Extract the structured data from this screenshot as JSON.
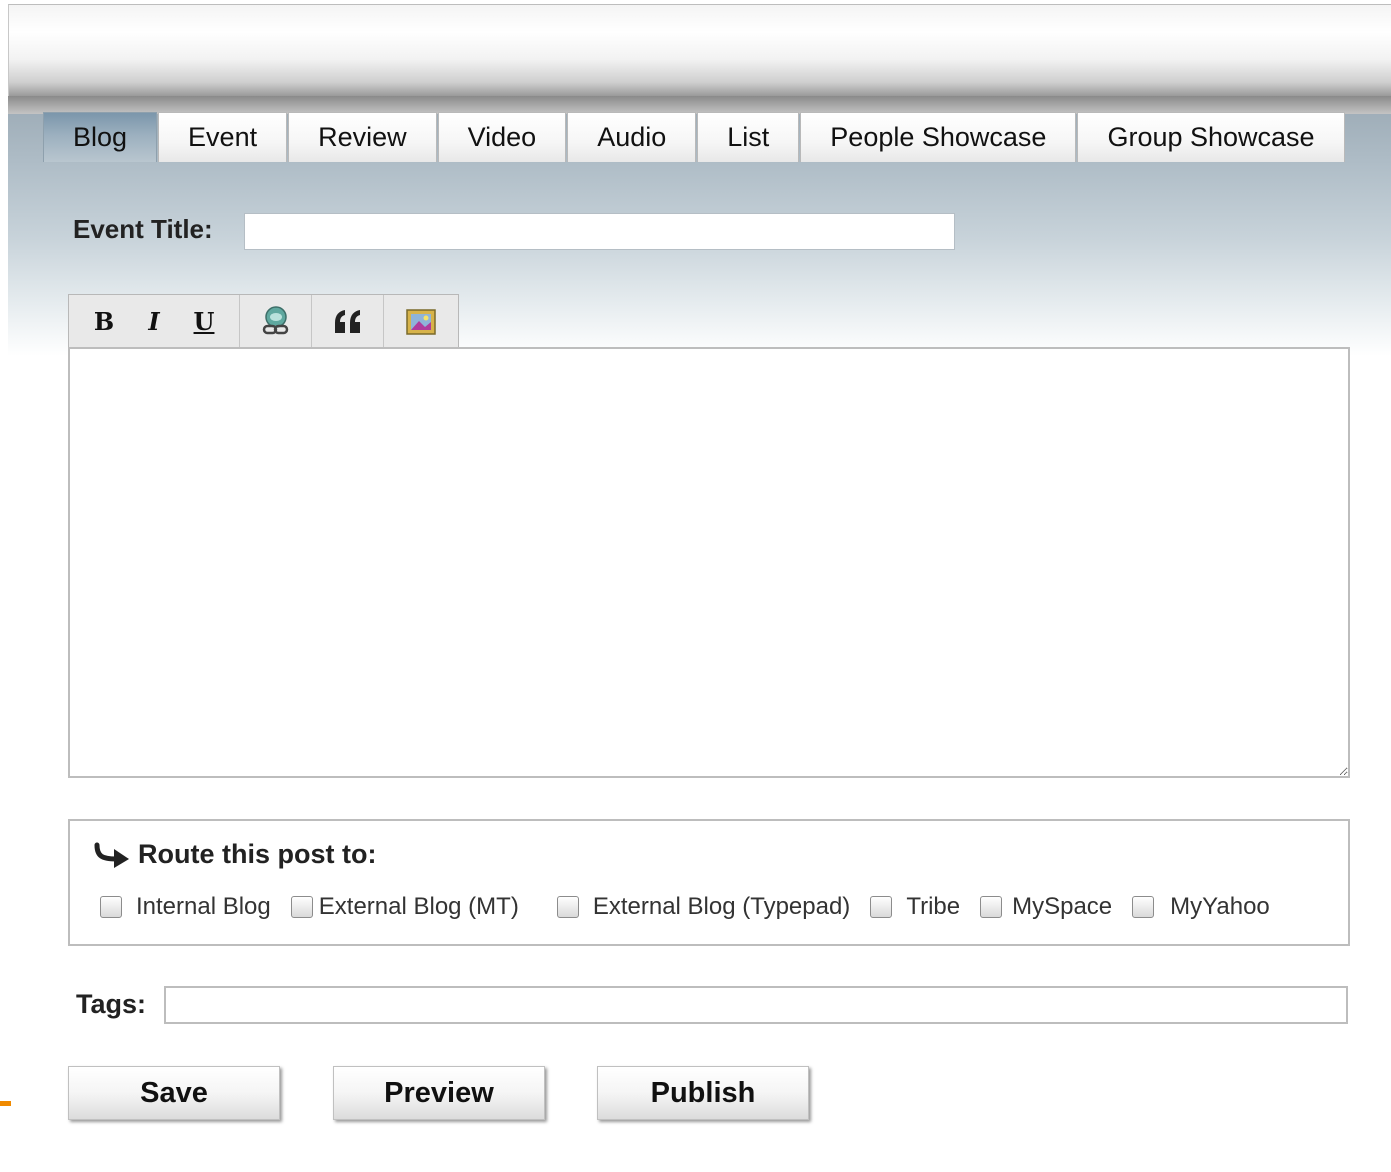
{
  "tabs": [
    {
      "label": "Blog",
      "active": true
    },
    {
      "label": "Event",
      "active": false
    },
    {
      "label": "Review",
      "active": false
    },
    {
      "label": "Video",
      "active": false
    },
    {
      "label": "Audio",
      "active": false
    },
    {
      "label": "List",
      "active": false
    },
    {
      "label": "People Showcase",
      "active": false
    },
    {
      "label": "Group Showcase",
      "active": false
    }
  ],
  "form": {
    "title_label": "Event Title:",
    "title_value": "",
    "tags_label": "Tags:",
    "tags_value": ""
  },
  "toolbar": {
    "bold": "B",
    "italic": "I",
    "underline": "U",
    "icons": [
      "bold-icon",
      "italic-icon",
      "underline-icon",
      "link-icon",
      "quote-icon",
      "image-icon"
    ]
  },
  "route": {
    "title": "Route this post to:",
    "options": [
      {
        "label": "Internal Blog",
        "checked": false
      },
      {
        "label": "External Blog (MT)",
        "checked": false
      },
      {
        "label": "External Blog (Typepad)",
        "checked": false
      },
      {
        "label": "Tribe",
        "checked": false
      },
      {
        "label": "MySpace",
        "checked": false
      },
      {
        "label": "MyYahoo",
        "checked": false
      }
    ]
  },
  "buttons": {
    "save": "Save",
    "preview": "Preview",
    "publish": "Publish"
  },
  "colors": {
    "accent": "#f08a00",
    "active_tab": "#7b96ab",
    "panel": "#aebcc6"
  }
}
